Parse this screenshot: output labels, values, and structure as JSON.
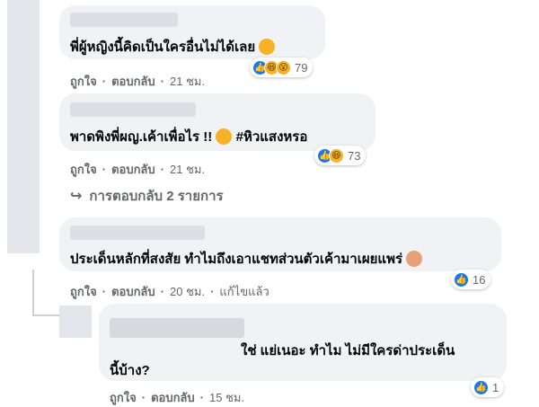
{
  "comments": [
    {
      "text": "พี่ผู้หญิงนี้คิดเป็นใครอื่นไม่ได้เลย",
      "reaction_count": "79",
      "reaction_icons": [
        "like-icon",
        "haha-icon",
        "wow-icon"
      ],
      "actions": {
        "like": "ถูกใจ",
        "reply": "ตอบกลับ",
        "time": "21 ชม."
      }
    },
    {
      "text": "พาดพิงพี่ผญ.เค้าเพื่อไร !!",
      "hashtag": "#หิวแสงหรอ",
      "reaction_count": "73",
      "reaction_icons": [
        "like-icon",
        "haha-icon"
      ],
      "actions": {
        "like": "ถูกใจ",
        "reply": "ตอบกลับ",
        "time": "21 ชม."
      },
      "replies_label": "การตอบกลับ 2 รายการ"
    },
    {
      "text": "ประเด็นหลักที่สงสัย ทำไมถึงเอาแชทส่วนตัวเค้ามาเผยแพร่",
      "reaction_count": "16",
      "reaction_icons": [
        "like-icon"
      ],
      "actions": {
        "like": "ถูกใจ",
        "reply": "ตอบกลับ",
        "time": "20 ชม.",
        "edited": "แก้ไขแล้ว"
      }
    },
    {
      "text_line1": "ใช่ แย่เนอะ ทำไม ไม่มีใครด่าประเด็น",
      "text_line2": "นี้บ้าง?",
      "reaction_count": "1",
      "reaction_icons": [
        "like-icon"
      ],
      "actions": {
        "like": "ถูกใจ",
        "reply": "ตอบกลับ",
        "time": "15 ชม."
      }
    }
  ],
  "colors": {
    "bubble": "#f0f2f5",
    "meta_text": "#65676b",
    "like_blue": "#1877f2",
    "emoji_yellow": "#f7b125"
  }
}
